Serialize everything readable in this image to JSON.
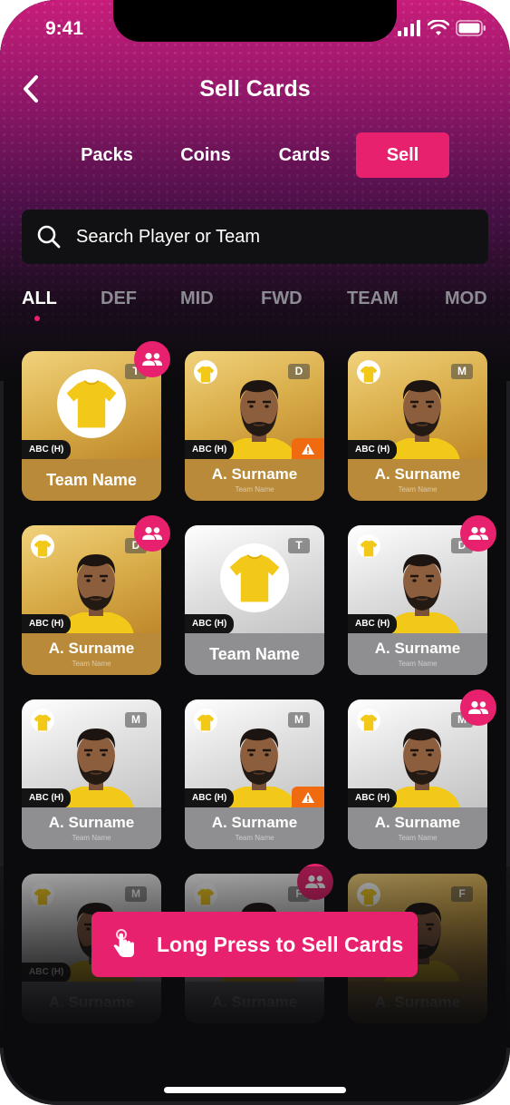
{
  "status_bar": {
    "time": "9:41"
  },
  "header": {
    "title": "Sell Cards"
  },
  "tabs": [
    {
      "label": "Packs",
      "active": false
    },
    {
      "label": "Coins",
      "active": false
    },
    {
      "label": "Cards",
      "active": false
    },
    {
      "label": "Sell",
      "active": true
    }
  ],
  "search": {
    "placeholder": "Search Player or Team"
  },
  "filters": [
    {
      "label": "ALL",
      "active": true
    },
    {
      "label": "DEF",
      "active": false
    },
    {
      "label": "MID",
      "active": false
    },
    {
      "label": "FWD",
      "active": false
    },
    {
      "label": "TEAM",
      "active": false
    },
    {
      "label": "MOD",
      "active": false
    }
  ],
  "cards": [
    {
      "tier": "gold",
      "kind": "team",
      "position": "T",
      "fixture": "ABC (H)",
      "name": "Team Name",
      "team": "",
      "group_badge": true,
      "warning": false
    },
    {
      "tier": "gold",
      "kind": "player",
      "position": "D",
      "fixture": "ABC (H)",
      "name": "A. Surname",
      "team": "Team Name",
      "group_badge": false,
      "warning": true
    },
    {
      "tier": "gold",
      "kind": "player",
      "position": "M",
      "fixture": "ABC (H)",
      "name": "A. Surname",
      "team": "Team Name",
      "group_badge": false,
      "warning": false
    },
    {
      "tier": "gold",
      "kind": "player",
      "position": "D",
      "fixture": "ABC (H)",
      "name": "A. Surname",
      "team": "Team Name",
      "group_badge": true,
      "warning": false
    },
    {
      "tier": "silver",
      "kind": "team",
      "position": "T",
      "fixture": "ABC (H)",
      "name": "Team Name",
      "team": "",
      "group_badge": false,
      "warning": false
    },
    {
      "tier": "silver",
      "kind": "player",
      "position": "D",
      "fixture": "ABC (H)",
      "name": "A. Surname",
      "team": "Team Name",
      "group_badge": true,
      "warning": false
    },
    {
      "tier": "silver",
      "kind": "player",
      "position": "M",
      "fixture": "ABC (H)",
      "name": "A. Surname",
      "team": "Team Name",
      "group_badge": false,
      "warning": false
    },
    {
      "tier": "silver",
      "kind": "player",
      "position": "M",
      "fixture": "ABC (H)",
      "name": "A. Surname",
      "team": "Team Name",
      "group_badge": false,
      "warning": true
    },
    {
      "tier": "silver",
      "kind": "player",
      "position": "M",
      "fixture": "ABC (H)",
      "name": "A. Surname",
      "team": "Team Name",
      "group_badge": true,
      "warning": false
    },
    {
      "tier": "silver",
      "kind": "player",
      "position": "M",
      "fixture": "ABC (H)",
      "name": "A. Surname",
      "team": "",
      "group_badge": false,
      "warning": false
    },
    {
      "tier": "silver",
      "kind": "player",
      "position": "F",
      "fixture": "",
      "name": "A. Surname",
      "team": "",
      "group_badge": true,
      "warning": false
    },
    {
      "tier": "gold",
      "kind": "player",
      "position": "F",
      "fixture": "",
      "name": "A. Surname",
      "team": "",
      "group_badge": false,
      "warning": false
    }
  ],
  "cta": {
    "label": "Long Press to Sell Cards"
  },
  "colors": {
    "accent": "#e8216e",
    "gold": "#d9ad4a",
    "silver": "#c6c6c6",
    "warning": "#f06a10",
    "shirt": "#f2c819"
  },
  "icons": [
    "back-chevron-icon",
    "search-icon",
    "group-icon",
    "warning-icon",
    "shirt-icon",
    "touch-icon",
    "signal-icon",
    "wifi-icon",
    "battery-icon"
  ]
}
